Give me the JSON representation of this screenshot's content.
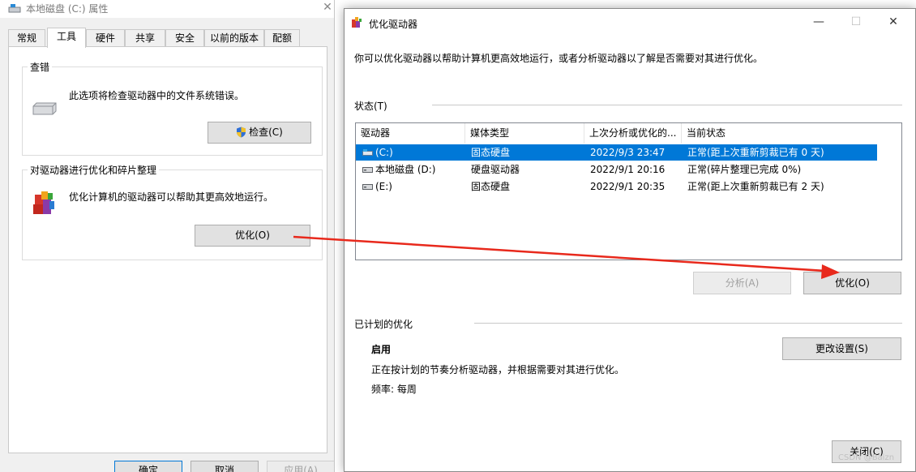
{
  "left_dialog": {
    "title": "本地磁盘 (C:) 属性",
    "close_glyph": "✕",
    "tabs": [
      "常规",
      "工具",
      "硬件",
      "共享",
      "安全",
      "以前的版本",
      "配额"
    ],
    "active_tab": "工具",
    "check_group": {
      "legend": "查错",
      "description": "此选项将检查驱动器中的文件系统错误。",
      "button": "检查(C)"
    },
    "optimize_group": {
      "legend": "对驱动器进行优化和碎片整理",
      "description": "优化计算机的驱动器可以帮助其更高效地运行。",
      "button": "优化(O)"
    },
    "bottom_buttons": [
      "确定",
      "取消",
      "应用(A)"
    ]
  },
  "optimize_window": {
    "title": "优化驱动器",
    "controls": {
      "minimize": "—",
      "maximize": "☐",
      "close": "✕"
    },
    "intro": "你可以优化驱动器以帮助计算机更高效地运行，或者分析驱动器以了解是否需要对其进行优化。",
    "status_label": "状态(T)",
    "columns": [
      "驱动器",
      "媒体类型",
      "上次分析或优化的...",
      "当前状态"
    ],
    "drives": [
      {
        "name": "(C:)",
        "media": "固态硬盘",
        "last": "2022/9/3 23:47",
        "status": "正常(距上次重新剪裁已有 0 天)",
        "selected": true
      },
      {
        "name": "本地磁盘 (D:)",
        "media": "硬盘驱动器",
        "last": "2022/9/1 20:16",
        "status": "正常(碎片整理已完成 0%)",
        "selected": false
      },
      {
        "name": "(E:)",
        "media": "固态硬盘",
        "last": "2022/9/1 20:35",
        "status": "正常(距上次重新剪裁已有 2 天)",
        "selected": false
      }
    ],
    "analyze_button": "分析(A)",
    "optimize_button": "优化(O)",
    "scheduled_label": "已计划的优化",
    "schedule_state": "启用",
    "schedule_desc": "正在按计划的节奏分析驱动器，并根据需要对其进行优化。",
    "frequency": "频率: 每周",
    "change_settings_button": "更改设置(S)",
    "close_button": "关闭(C)"
  },
  "watermark": "CSDN @Baizn",
  "colors": {
    "selection": "#0078d7",
    "annotation_arrow": "#e8291c"
  }
}
